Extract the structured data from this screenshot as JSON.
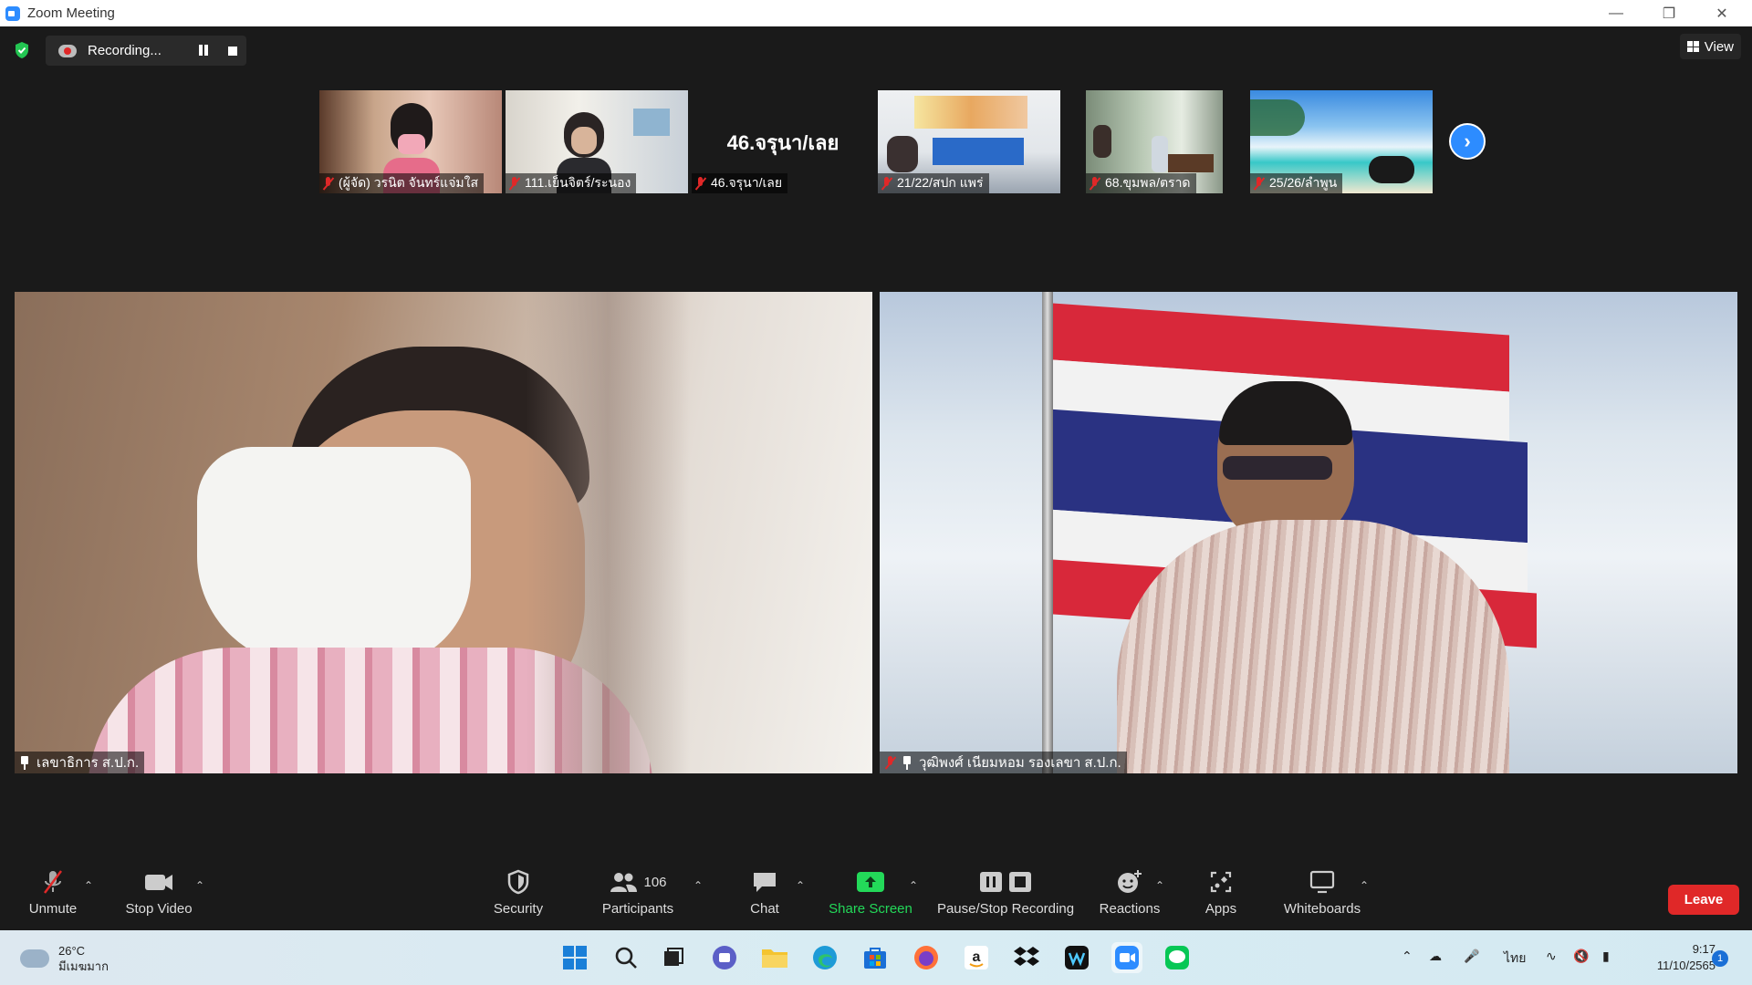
{
  "window": {
    "title": "Zoom Meeting"
  },
  "recording": {
    "status": "Recording..."
  },
  "view": {
    "label": "View"
  },
  "thumbnails": [
    {
      "name": "(ผู้จัด) วรนิต จันทร์แจ่มใส"
    },
    {
      "name": "111.เย็นจิตร์/ระนอง"
    },
    {
      "name": "46.จรุนา/เลย",
      "display": "46.จรุนา/เลย"
    },
    {
      "name": "21/22/สปก แพร่"
    },
    {
      "name": "68.ขุมพล/ตราด"
    },
    {
      "name": "25/26/ลำพูน"
    }
  ],
  "main_videos": [
    {
      "name": "เลขาธิการ ส.ป.ก."
    },
    {
      "name": "วุฒิพงศ์ เนียมหอม รองเลขา ส.ป.ก."
    }
  ],
  "toolbar": {
    "unmute": "Unmute",
    "stop_video": "Stop Video",
    "security": "Security",
    "participants": "Participants",
    "participants_count": "106",
    "chat": "Chat",
    "share_screen": "Share Screen",
    "pause_stop_recording": "Pause/Stop Recording",
    "reactions": "Reactions",
    "apps": "Apps",
    "whiteboards": "Whiteboards",
    "leave": "Leave"
  },
  "colors": {
    "accent": "#2d8cff",
    "leave": "#e02828",
    "share": "#23d959"
  },
  "taskbar": {
    "weather_temp": "26°C",
    "weather_desc": "มีเมฆมาก",
    "language": "ไทย",
    "time": "9:17",
    "date": "11/10/2565",
    "notifications": "1"
  }
}
